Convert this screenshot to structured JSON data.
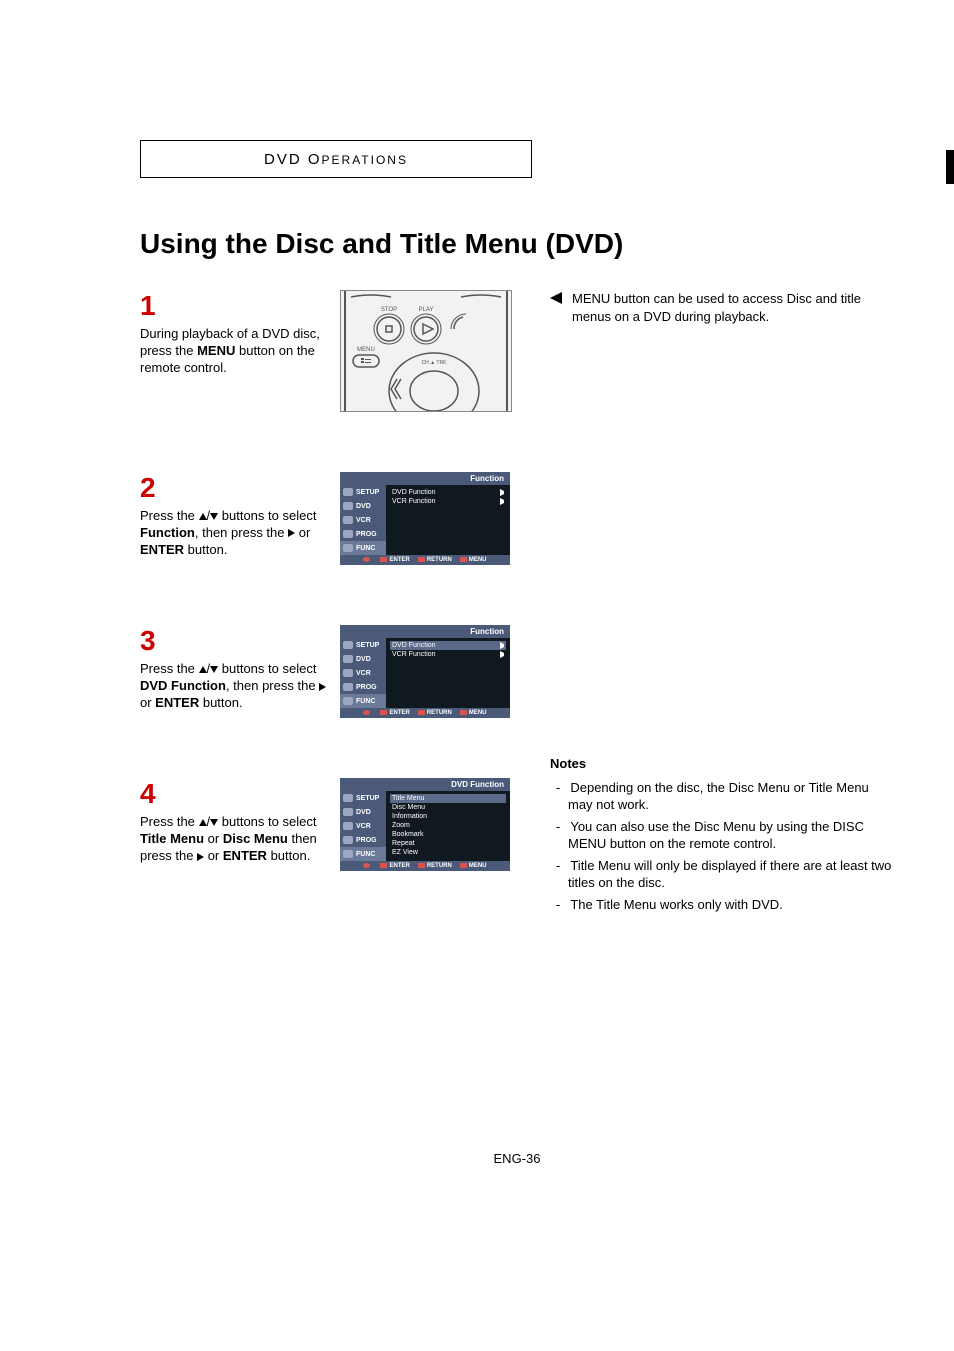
{
  "category": {
    "prefix": "DVD O",
    "rest": "PERATIONS"
  },
  "title": "Using the Disc and Title Menu (DVD)",
  "callout": "MENU button can be used to access Disc and title menus on a DVD during playback.",
  "steps": {
    "s1": {
      "num": "1",
      "a": "During playback of a DVD disc, press the ",
      "b": "MENU",
      "c": " button on the remote control."
    },
    "s2": {
      "num": "2",
      "a": "Press the ",
      "b": " buttons to select ",
      "c": "Function",
      "d": ", then press the ",
      "e": " or ",
      "f": "ENTER",
      "g": " button."
    },
    "s3": {
      "num": "3",
      "a": "Press the ",
      "b": " buttons to select ",
      "c": "DVD Function",
      "d": ", then press the ",
      "e": " or ",
      "f": "ENTER",
      "g": " button."
    },
    "s4": {
      "num": "4",
      "a": "Press the ",
      "b": " buttons to select ",
      "c": "Title Menu",
      "d": " or ",
      "e": "Disc Menu",
      "f": " then press the ",
      "g": " or ",
      "h": "ENTER",
      "i": " button."
    }
  },
  "osd": {
    "side": {
      "setup": "SETUP",
      "dvd": "DVD",
      "vcr": "VCR",
      "prog": "PROG",
      "func": "FUNC"
    },
    "foot": {
      "enter": "ENTER",
      "ret": "RETURN",
      "menu": "MENU"
    },
    "func_head": "Function",
    "dvdfunc_head": "DVD Function",
    "func_items": {
      "a": "DVD Function",
      "b": "VCR Function"
    },
    "dvdfunc_items": {
      "a": "Title Menu",
      "b": "Disc Menu",
      "c": "Information",
      "d": "Zoom",
      "e": "Bookmark",
      "f": "Repeat",
      "g": "EZ View"
    }
  },
  "remote": {
    "stop": "STOP",
    "play": "PLAY",
    "menu": "MENU",
    "chtrk": "CH ▲ TRK"
  },
  "notes": {
    "head": "Notes",
    "n1": "Depending on the disc, the Disc Menu or Title Menu may not work.",
    "n2": "You can also use the Disc Menu by using the DISC MENU button on the remote control.",
    "n3": "Title Menu will only be displayed if there are at least two titles on the disc.",
    "n4": "The Title Menu works only with DVD."
  },
  "footer": "ENG-36"
}
